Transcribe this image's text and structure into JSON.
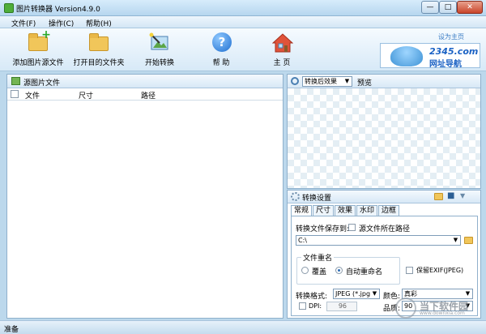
{
  "window": {
    "title": "图片转换器 Version4.9.0",
    "min": "—",
    "max": "□",
    "close": "✕"
  },
  "menu": [
    "文件(F)",
    "操作(C)",
    "帮助(H)"
  ],
  "toolbar": {
    "add_source": "添加图片源文件",
    "open_target": "打开目的文件夹",
    "start": "开始转换",
    "help": "帮  助",
    "home": "主  页"
  },
  "ad": {
    "link": "设为主页",
    "logo": "2345.com",
    "sub": "网址导航"
  },
  "source_panel": {
    "title": "源图片文件",
    "columns": [
      "文件",
      "尺寸",
      "路径"
    ]
  },
  "preview": {
    "select_value": "转换后效果",
    "label": "预览"
  },
  "settings": {
    "title": "转换设置",
    "tabs": [
      "常规",
      "尺寸",
      "效果",
      "水印",
      "边框"
    ],
    "save_to_label": "转换文件保存到:",
    "source_path_label": "源文件所在路径",
    "path_value": "C:\\",
    "rename_group": "文件重名",
    "overwrite": "覆盖",
    "auto_rename": "自动重命名",
    "keep_exif": "保留EXIF(JPEG)",
    "format_label": "转换格式:",
    "format_value": "JPEG (*.jpg",
    "color_label": "颜色:",
    "color_value": "真彩",
    "dpi_label": "DPI:",
    "dpi_value": "96",
    "quality_label": "品质:",
    "quality_value": "90"
  },
  "status": "准备",
  "watermark": {
    "text": "当下软件园",
    "url": "www.downxia.com"
  }
}
